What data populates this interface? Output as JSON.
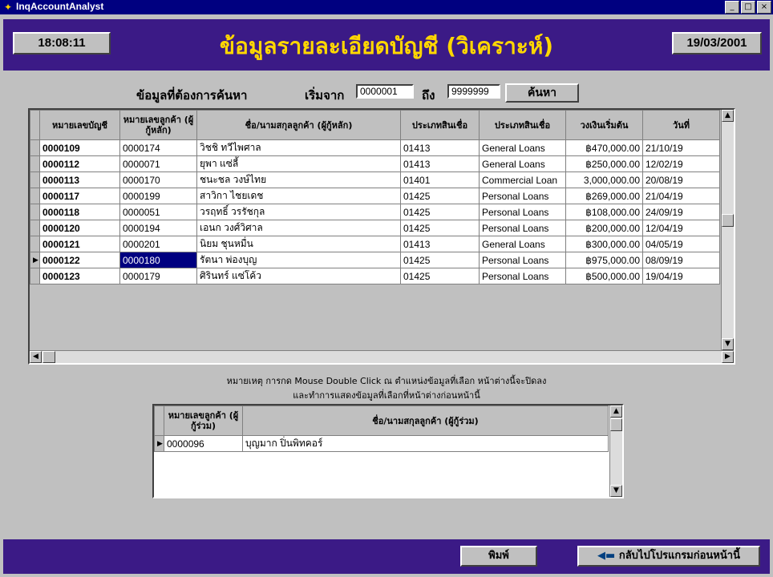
{
  "window": {
    "title": "InqAccountAnalyst",
    "controls": [
      "_",
      "□",
      "×"
    ]
  },
  "header": {
    "time": "18:08:11",
    "title": "ข้อมูลรายละเอียดบัญชี (วิเคราะห์)",
    "date": "19/03/2001"
  },
  "search": {
    "label": "ข้อมูลที่ต้องการค้นหา",
    "from_label": "เริ่มจาก",
    "from_value": "0000001",
    "to_label": "ถึง",
    "to_value": "9999999",
    "button": "ค้นหา"
  },
  "main_table": {
    "columns": [
      "หมายเลขบัญชี",
      "หมายเลขลูกค้า (ผู้กู้หลัก)",
      "ชื่อ/นามสกุลลูกค้า (ผู้กู้หลัก)",
      "ประเภทสินเชื่อ",
      "ประเภทสินเชื่อ",
      "วงเงินเริ่มต้น",
      "วันที่"
    ],
    "rows": [
      [
        "0000109",
        "0000174",
        "วิชชิ ทวีไพศาล",
        "01413",
        "General Loans",
        "฿470,000.00",
        "21/10/19"
      ],
      [
        "0000112",
        "0000071",
        "ยุพา แซ่ลี้",
        "01413",
        "General Loans",
        "฿250,000.00",
        "12/02/19"
      ],
      [
        "0000113",
        "0000170",
        "ชนะชล วงษ์ไทย",
        "01401",
        "Commercial Loan",
        "3,000,000.00",
        "20/08/19"
      ],
      [
        "0000117",
        "0000199",
        "สาวิกา ไชยเดช",
        "01425",
        "Personal Loans",
        "฿269,000.00",
        "21/04/19"
      ],
      [
        "0000118",
        "0000051",
        "วรฤทธิ์ วรรัชกุล",
        "01425",
        "Personal Loans",
        "฿108,000.00",
        "24/09/19"
      ],
      [
        "0000120",
        "0000194",
        "เอนก วงศ์วิศาล",
        "01425",
        "Personal Loans",
        "฿200,000.00",
        "12/04/19"
      ],
      [
        "0000121",
        "0000201",
        "นิยม ชุนหมื่น",
        "01413",
        "General Loans",
        "฿300,000.00",
        "04/05/19"
      ],
      [
        "0000122",
        "0000180",
        "รัตนา พ่องบุญ",
        "01425",
        "Personal Loans",
        "฿975,000.00",
        "08/09/19"
      ],
      [
        "0000123",
        "0000179",
        "ศิรินทร์ แซ่โค้ว",
        "01425",
        "Personal Loans",
        "฿500,000.00",
        "19/04/19"
      ]
    ],
    "current_row_index": 7
  },
  "note": {
    "line1": "หมายเหตุ การกด Mouse Double Click ณ ตำแหน่งข้อมูลที่เลือก หน้าต่างนี้จะปิดลง",
    "line2": "และทำการแสดงข้อมูลที่เลือกที่หน้าต่างก่อนหน้านี้"
  },
  "co_table": {
    "columns": [
      "หมายเลขลูกค้า (ผู้กู้ร่วม)",
      "ชื่อ/นามสกุลลูกค้า (ผู้กู้ร่วม)"
    ],
    "rows": [
      [
        "0000096",
        "บุญมาก ปิ่นพิทคอร์"
      ]
    ]
  },
  "footer": {
    "print_button": "พิมพ์",
    "back_button": "กลับไปโปรแกรมก่อนหน้านี้"
  },
  "colors": {
    "titlebar": "#000080",
    "panel": "#3b1a86",
    "header_text": "#ffd700",
    "window_bg": "#c0c0c0"
  }
}
